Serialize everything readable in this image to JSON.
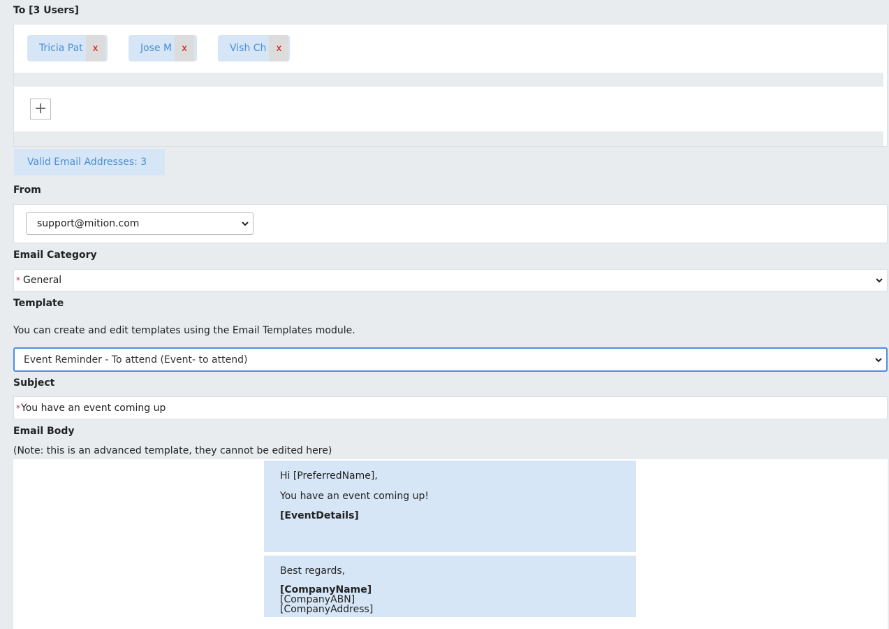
{
  "to": {
    "label": "To [3 Users]",
    "recipients": [
      {
        "name": "Tricia Pat",
        "remove": "x"
      },
      {
        "name": "Jose M",
        "remove": "x"
      },
      {
        "name": "Vish Ch",
        "remove": "x"
      }
    ],
    "add_button": "+",
    "valid_count_text": "Valid Email Addresses: 3"
  },
  "from": {
    "label": "From",
    "value": "support@mition.com"
  },
  "category": {
    "label": "Email Category",
    "required_mark": "*",
    "value": "General"
  },
  "template": {
    "label": "Template",
    "help": "You can create and edit templates using the Email Templates module.",
    "value": "Event Reminder - To attend (Event- to attend)"
  },
  "subject": {
    "label": "Subject",
    "required_mark": "*",
    "value": "You have an event coming up"
  },
  "body": {
    "label": "Email Body",
    "note": "(Note: this is an advanced template, they cannot be edited here)",
    "greeting": "Hi [PreferredName],",
    "line1": "You have an event coming up!",
    "details": "[EventDetails]",
    "closing": "Best regards,",
    "company_name": "[CompanyName]",
    "company_abn": "[CompanyABN]",
    "company_address": "[CompanyAddress]"
  },
  "colors": {
    "accent": "#4a8fd6",
    "chip_bg": "#d6e6f7",
    "remove": "#e00000",
    "focus_border": "#4a90e2",
    "page_bg": "#e9ecef"
  }
}
